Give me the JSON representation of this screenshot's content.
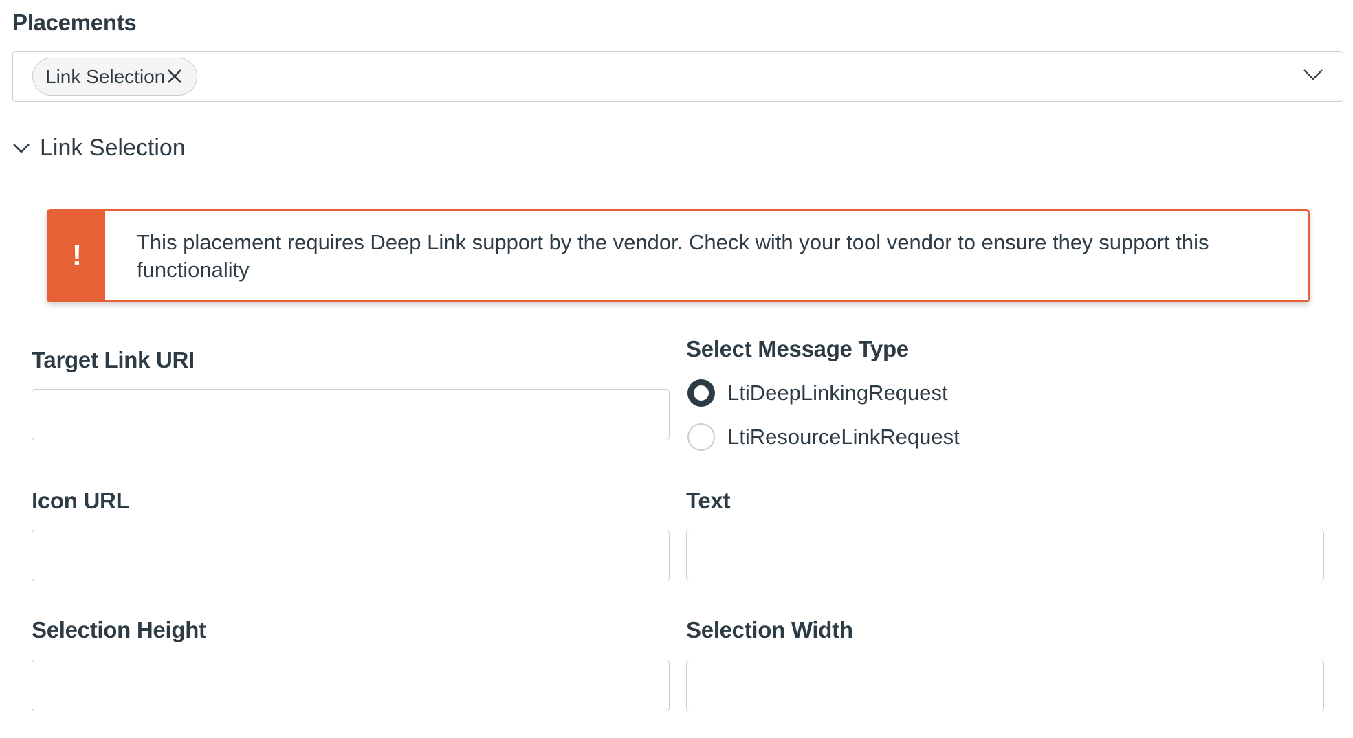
{
  "placements": {
    "label": "Placements",
    "selected_tags": [
      {
        "label": "Link Selection"
      }
    ]
  },
  "section": {
    "title": "Link Selection",
    "alert": {
      "icon": "!",
      "text": "This placement requires Deep Link support by the vendor. Check with your tool vendor to ensure they support this functionality"
    }
  },
  "fields": {
    "target_link_uri": {
      "label": "Target Link URI",
      "value": ""
    },
    "message_type": {
      "label": "Select Message Type",
      "options": [
        {
          "label": "LtiDeepLinkingRequest",
          "checked": true
        },
        {
          "label": "LtiResourceLinkRequest",
          "checked": false
        }
      ]
    },
    "icon_url": {
      "label": "Icon URL",
      "value": ""
    },
    "text": {
      "label": "Text",
      "value": ""
    },
    "selection_height": {
      "label": "Selection Height",
      "value": ""
    },
    "selection_width": {
      "label": "Selection Width",
      "value": ""
    }
  },
  "colors": {
    "warning": "#e66135",
    "text": "#2d3b45",
    "border": "#c7cdd1"
  }
}
